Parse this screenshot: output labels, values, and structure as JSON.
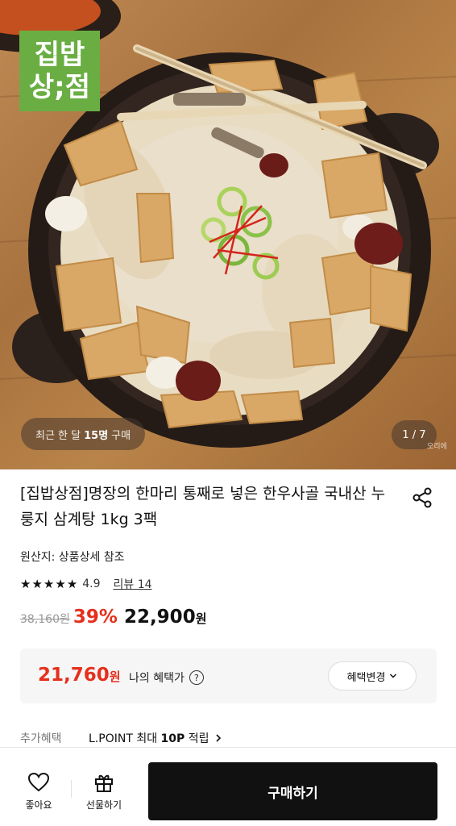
{
  "hero": {
    "brand_line1": "집밥",
    "brand_line2": "상;점",
    "recent_purchase_prefix": "최근 한 달",
    "recent_purchase_count": "15명",
    "recent_purchase_suffix": "구매",
    "pager": "1 / 7",
    "watermark": "오리에"
  },
  "product": {
    "title": "[집밥상점]명장의 한마리 통째로 넣은 한우사골 국내산 누룽지 삼계탕 1kg 3팩",
    "origin": "원산지: 상품상세 참조",
    "rating_stars": 5,
    "rating_score": "4.9",
    "review_label": "리뷰 14",
    "original_price": "38,160원",
    "discount_rate": "39%",
    "final_price": "22,900",
    "won": "원"
  },
  "benefit": {
    "price": "21,760",
    "won": "원",
    "label": "나의 혜택가",
    "help_icon": "?",
    "change_button": "혜택변경"
  },
  "extra": {
    "label": "추가혜택",
    "value_prefix": "L.POINT 최대",
    "value_bold": "10P",
    "value_suffix": "적립"
  },
  "bottom_bar": {
    "like_label": "좋아요",
    "gift_label": "선물하기",
    "buy_label": "구매하기"
  },
  "colors": {
    "accent_red": "#e5301e",
    "brand_green": "#6aae43",
    "buy_button": "#111111"
  },
  "icons": [
    "share-icon",
    "star-icon",
    "help-icon",
    "chevron-down-icon",
    "chevron-right-icon",
    "heart-icon",
    "gift-icon"
  ]
}
